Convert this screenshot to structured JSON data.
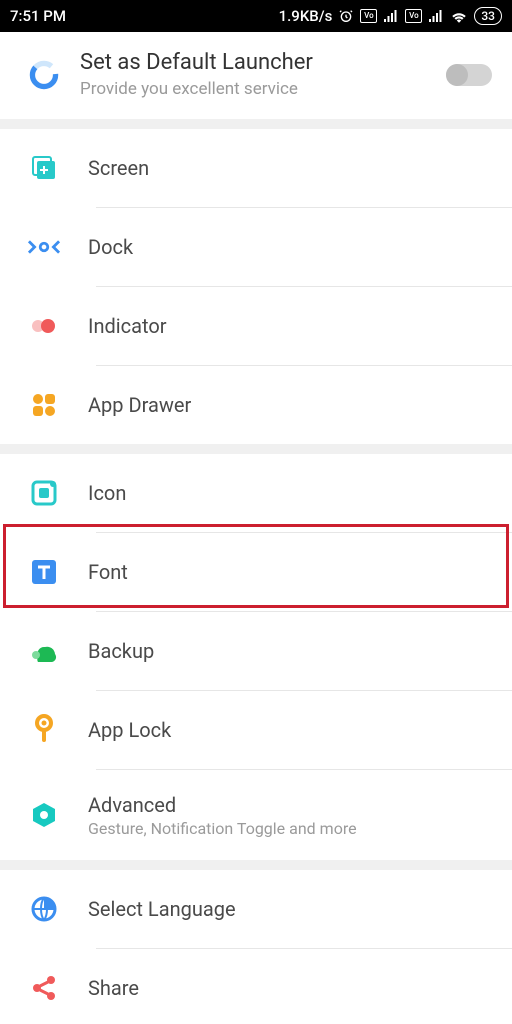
{
  "status": {
    "time": "7:51 PM",
    "data_rate": "1.9KB/s",
    "volte_label": "Vo LTE",
    "battery": "33"
  },
  "header": {
    "title": "Set as Default Launcher",
    "subtitle": "Provide you excellent service",
    "toggle_on": false
  },
  "groups": [
    {
      "items": [
        {
          "key": "screen",
          "label": "Screen"
        },
        {
          "key": "dock",
          "label": "Dock"
        },
        {
          "key": "indicator",
          "label": "Indicator"
        },
        {
          "key": "appdrawer",
          "label": "App Drawer"
        }
      ]
    },
    {
      "items": [
        {
          "key": "icon",
          "label": "Icon"
        },
        {
          "key": "font",
          "label": "Font",
          "highlighted": true
        },
        {
          "key": "backup",
          "label": "Backup"
        },
        {
          "key": "applock",
          "label": "App Lock"
        },
        {
          "key": "advanced",
          "label": "Advanced",
          "sub": "Gesture, Notification Toggle and more"
        }
      ]
    },
    {
      "items": [
        {
          "key": "language",
          "label": "Select Language"
        },
        {
          "key": "share",
          "label": "Share"
        }
      ]
    }
  ],
  "colors": {
    "teal": "#28c9c9",
    "blue": "#3b8ef0",
    "coral": "#f05a5a",
    "orange": "#f5a623",
    "green": "#1db954",
    "cyan": "#17c9c0",
    "red_outline": "#cc1f2f"
  }
}
